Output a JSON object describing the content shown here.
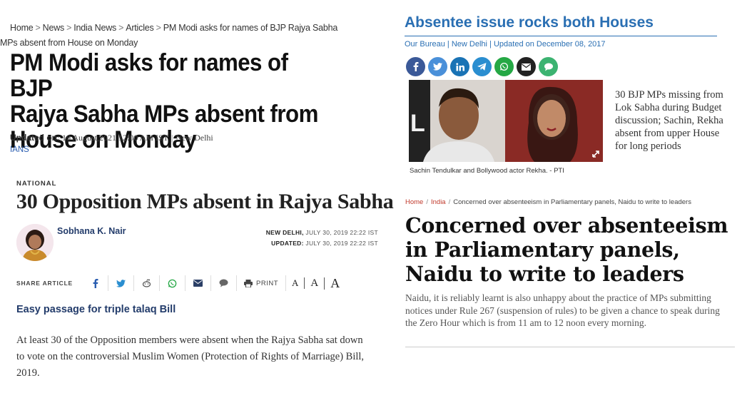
{
  "pm_article": {
    "breadcrumb": [
      "Home",
      "News",
      "India News",
      "Articles",
      "PM Modi asks for names of BJP Rajya Sabha"
    ],
    "breadcrumb_overflow": "MPs absent from House on Monday",
    "breadcrumb_sep": ">",
    "headline_lines": [
      "PM Modi asks for names of BJP",
      "Rajya Sabha MPs absent from",
      "House on Monday"
    ],
    "updated_label": "Updated on:",
    "updated_value": "10 August,2021 12:00 AM IST",
    "location": "New Delhi",
    "source": "IANS"
  },
  "opposition_article": {
    "section": "NATIONAL",
    "headline": "30 Opposition MPs absent in Rajya Sabha",
    "author": "Sobhana K. Nair",
    "dateline_place": "NEW DELHI,",
    "dateline_date": "JULY 30, 2019 22:22 IST",
    "updated_label": "UPDATED:",
    "updated_date": "JULY 30, 2019 22:22 IST",
    "share_label": "SHARE ARTICLE",
    "share_icons": [
      "facebook-icon",
      "twitter-icon",
      "reddit-icon",
      "whatsapp-icon",
      "email-icon",
      "comment-icon"
    ],
    "print_label": "PRINT",
    "font_sizes": [
      "A",
      "A",
      "A"
    ],
    "subhead": "Easy passage for triple talaq Bill",
    "body": "At least 30 of the Opposition members were absent when the Rajya Sabha sat down to vote on the controversial Muslim Women (Protection of Rights of Marriage) Bill, 2019."
  },
  "absentee_article": {
    "title": "Absentee issue rocks both Houses",
    "author": "Our Bureau",
    "location": "New Delhi",
    "updated": "Updated on December 08, 2017",
    "share_icons": [
      "facebook-icon",
      "twitter-icon",
      "linkedin-icon",
      "telegram-icon",
      "whatsapp-icon",
      "email-icon",
      "chat-icon"
    ],
    "share_colors": [
      "#3b5998",
      "#4a90d9",
      "#1a73b5",
      "#2a8ed0",
      "#25a845",
      "#222222",
      "#3cb371"
    ],
    "photo_caption": "Sachin Tendulkar and Bollywood actor Rekha.  - PTI",
    "teaser": "30 BJP MPs missing from Lok Sabha during Budget discussion; Sachin, Rekha absent from upper House for long periods"
  },
  "naidu_article": {
    "breadcrumb": [
      "Home",
      "India",
      "Concerned over absenteeism in Parliamentary panels, Naidu to write to leaders"
    ],
    "headline_lines": [
      "Concerned over absenteeism",
      "in Parliamentary panels,",
      "Naidu to write to leaders"
    ],
    "body": "Naidu, it is reliably learnt is also unhappy about the practice of MPs submitting notices under Rule 267 (suspension of rules) to be given a chance to speak during the Zero Hour which is from 11 am to 12 noon every morning."
  }
}
